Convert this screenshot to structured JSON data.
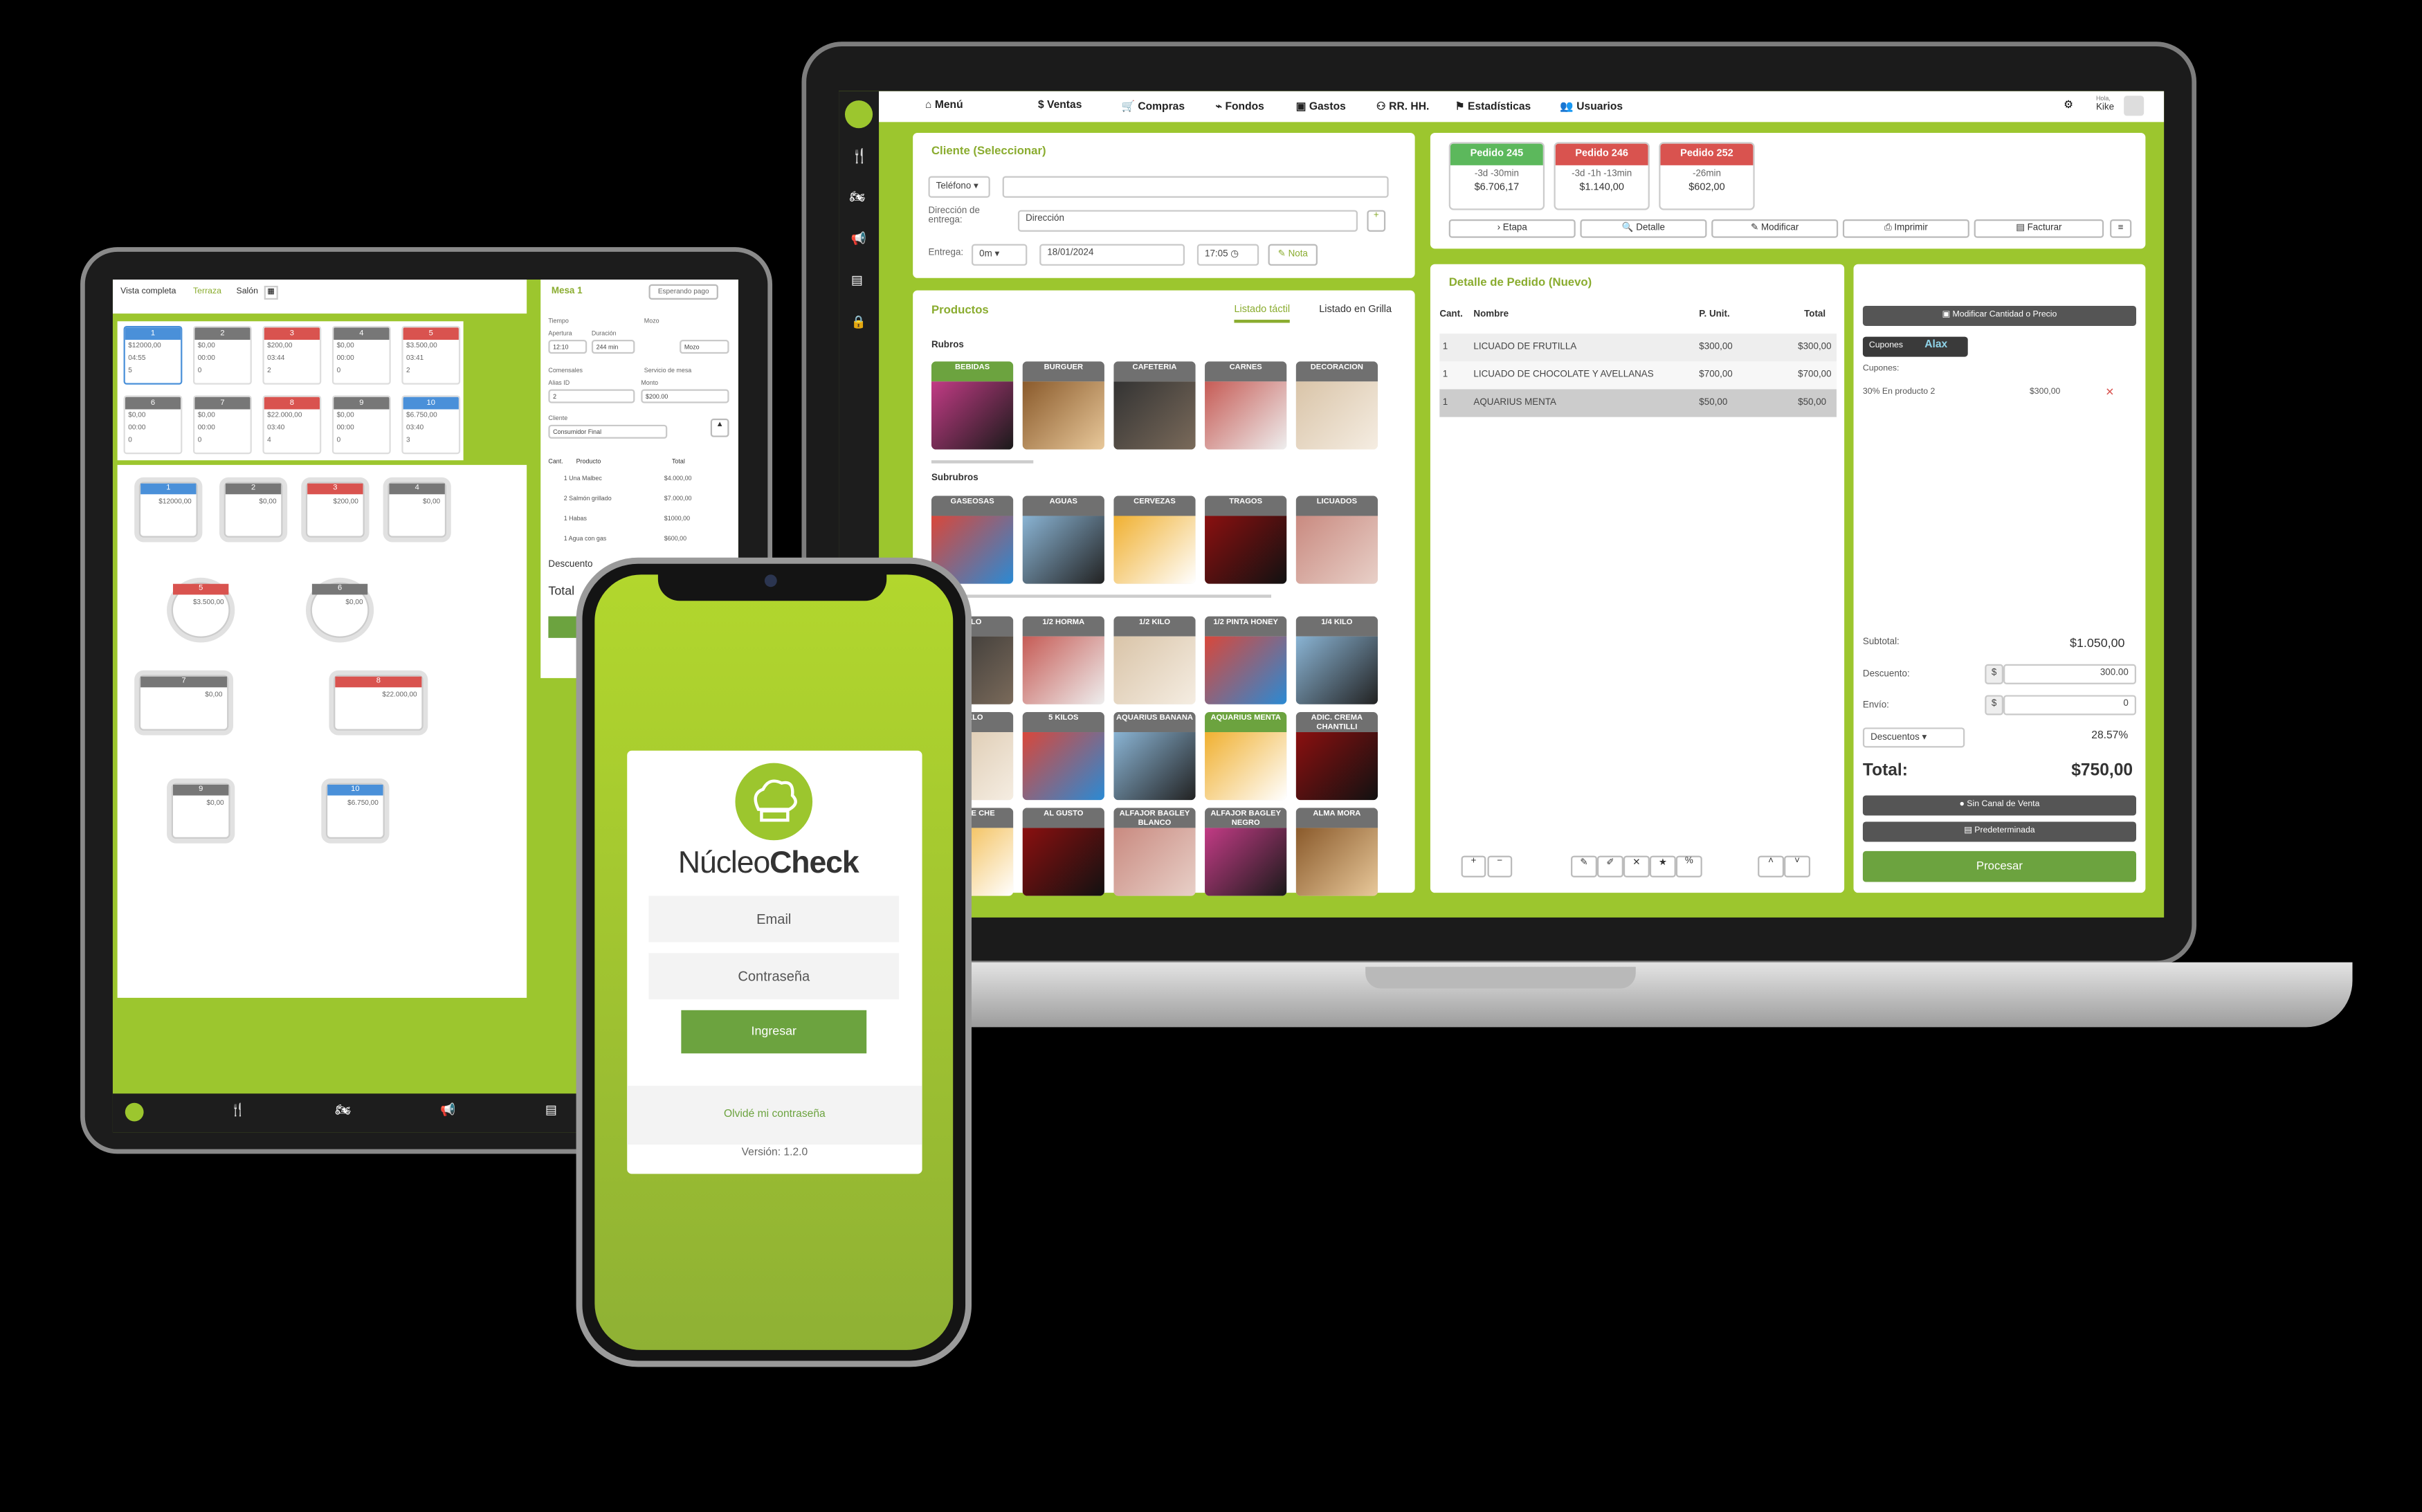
{
  "laptop": {
    "nav": [
      "Menú",
      "Ventas",
      "Compras",
      "Fondos",
      "Gastos",
      "RR. HH.",
      "Estadísticas",
      "Usuarios"
    ],
    "user": {
      "greeting": "Hola,",
      "name": "Kike"
    },
    "cliente": {
      "title": "Cliente (Seleccionar)",
      "phone_label": "Teléfono",
      "address_label": "Dirección de entrega:",
      "address_value": "Dirección",
      "entrega_label": "Entrega:",
      "entrega_time": "0m",
      "date": "18/01/2024",
      "time": "17:05",
      "note_btn": "Nota"
    },
    "pedidos": [
      {
        "label": "Pedido 245",
        "time": "-3d -30min",
        "amount": "$6.706,17",
        "color": "#5cb85c"
      },
      {
        "label": "Pedido 246",
        "time": "-3d -1h -13min",
        "amount": "$1.140,00",
        "color": "#d9534f"
      },
      {
        "label": "Pedido 252",
        "time": "-26min",
        "amount": "$602,00",
        "color": "#d9534f"
      }
    ],
    "actions": [
      "Etapa",
      "Detalle",
      "Modificar",
      "Imprimir",
      "Facturar"
    ],
    "productos": {
      "title": "Productos",
      "tab_touch": "Listado táctil",
      "tab_grid": "Listado en Grilla",
      "rubros_label": "Rubros",
      "subrubros_label": "Subrubros"
    },
    "rubros": [
      "BEBIDAS",
      "BURGUER",
      "CAFETERIA",
      "CARNES",
      "DECORACION"
    ],
    "subrubros": [
      "GASEOSAS",
      "AGUAS",
      "CERVEZAS",
      "TRAGOS",
      "LICUADOS"
    ],
    "prod_row1": [
      "KILO",
      "1/2 HORMA",
      "1/2 KILO",
      "1/2 PINTA HONEY",
      "1/4 KILO"
    ],
    "prod_row2": [
      "CELO",
      "5 KILOS",
      "AQUARIUS BANANA",
      "AQUARIUS MENTA",
      "ADIC. CREMA CHANTILLI"
    ],
    "prod_row3": [
      "DULCE CHE",
      "AL GUSTO",
      "ALFAJOR BAGLEY BLANCO",
      "ALFAJOR BAGLEY NEGRO",
      "ALMA MORA"
    ],
    "detalle": {
      "title": "Detalle de Pedido (Nuevo)",
      "cols": [
        "Cant.",
        "Nombre",
        "P. Unit.",
        "Total"
      ],
      "rows": [
        {
          "cant": "1",
          "nombre": "LICUADO DE FRUTILLA",
          "unit": "$300,00",
          "total": "$300,00"
        },
        {
          "cant": "1",
          "nombre": "LICUADO DE CHOCOLATE Y AVELLANAS",
          "unit": "$700,00",
          "total": "$700,00"
        },
        {
          "cant": "1",
          "nombre": "AQUARIUS MENTA",
          "unit": "$50,00",
          "total": "$50,00"
        }
      ]
    },
    "resumen": {
      "modify_btn": "Modificar Cantidad o Precio",
      "cupones_btn": "Cupones",
      "alax": "Alax",
      "cupones_label": "Cupones:",
      "cupon_name": "30% En producto 2",
      "cupon_amount": "$300,00",
      "subtotal_label": "Subtotal:",
      "subtotal": "$1.050,00",
      "descuento_label": "Descuento:",
      "descuento_value": "300.00",
      "envio_label": "Envío:",
      "envio_value": "0",
      "currency": "$",
      "descuentos_select": "Descuentos",
      "percent": "28.57%",
      "total_label": "Total:",
      "total": "$750,00",
      "canal_btn": "Sin Canal de Venta",
      "pred_btn": "Predeterminada",
      "procesar": "Procesar"
    }
  },
  "tablet": {
    "tabs": [
      "Vista completa",
      "Terraza",
      "Salón"
    ],
    "mesa": "Mesa 1",
    "estado": "Esperando pago",
    "fields": {
      "tiempo": "Tiempo",
      "mozo": "Mozo",
      "apertura": "Apertura",
      "duracion": "Duración",
      "apertura_v": "12:10",
      "duracion_v": "244 min",
      "mozo_v": "Mozo",
      "comensales": "Comensales",
      "servicio": "Servicio de mesa",
      "alias": "Alias ID",
      "monto": "Monto",
      "alias_v": "2",
      "monto_v": "$200.00",
      "cliente": "Cliente",
      "cliente_v": "Consumidor Final"
    },
    "cols": [
      "Cant.",
      "Producto",
      "Total"
    ],
    "items": [
      {
        "p": "1 Una Malbec",
        "t": "$4.000,00"
      },
      {
        "p": "2 Salmón grillado",
        "t": "$7.000,00"
      },
      {
        "p": "1 Habas",
        "t": "$1000,00"
      },
      {
        "p": "1 Agua con gas",
        "t": "$600,00"
      }
    ],
    "descuento": "Descuento",
    "total": "Total",
    "cards": [
      {
        "n": "1",
        "c": "#4a90d9",
        "a": "$12000,00",
        "b": "04:55",
        "d": "5"
      },
      {
        "n": "2",
        "c": "#777",
        "a": "$0,00",
        "b": "00:00",
        "d": "0"
      },
      {
        "n": "3",
        "c": "#d9534f",
        "a": "$200,00",
        "b": "03:44",
        "d": "2"
      },
      {
        "n": "4",
        "c": "#777",
        "a": "$0,00",
        "b": "00:00",
        "d": "0"
      },
      {
        "n": "5",
        "c": "#d9534f",
        "a": "$3.500,00",
        "b": "03:41",
        "d": "2"
      },
      {
        "n": "6",
        "c": "#777",
        "a": "$0,00",
        "b": "00:00",
        "d": "0"
      },
      {
        "n": "7",
        "c": "#777",
        "a": "$0,00",
        "b": "00:00",
        "d": "0"
      },
      {
        "n": "8",
        "c": "#d9534f",
        "a": "$22.000,00",
        "b": "03:40",
        "d": "4"
      },
      {
        "n": "9",
        "c": "#777",
        "a": "$0,00",
        "b": "00:00",
        "d": "0"
      },
      {
        "n": "10",
        "c": "#4a90d9",
        "a": "$6.750,00",
        "b": "03:40",
        "d": "3"
      }
    ]
  },
  "phone": {
    "brand_light": "Núcleo",
    "brand_bold": "Check",
    "email": "Email",
    "password": "Contraseña",
    "login": "Ingresar",
    "forgot": "Olvidé mi contraseña",
    "version": "Versión: 1.2.0"
  }
}
